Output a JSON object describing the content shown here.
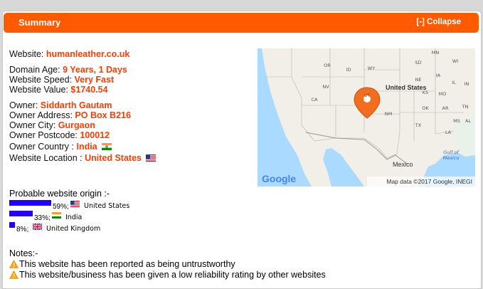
{
  "header": {
    "title": "Summary",
    "collapse_label": "[-] Collapse"
  },
  "website": {
    "label": "Website:",
    "value": "humanleather.co.uk"
  },
  "domain_age": {
    "label": "Domain Age:",
    "value": "9 Years, 1 Days"
  },
  "speed": {
    "label": "Website Speed:",
    "value": "Very Fast"
  },
  "site_value": {
    "label": "Website Value:",
    "value": "$1740.54"
  },
  "owner": {
    "label": "Owner:",
    "value": "Siddarth Gautam"
  },
  "owner_address": {
    "label": "Owner Address:",
    "value": "PO Box B216"
  },
  "owner_city": {
    "label": "Owner City:",
    "value": "Gurgaon"
  },
  "owner_postcode": {
    "label": "Owner Postcode:",
    "value": "100012"
  },
  "owner_country": {
    "label": "Owner Country :",
    "value": "India",
    "flag": "india-flag-icon"
  },
  "website_location": {
    "label": "Website Location  :",
    "value": "United States",
    "flag": "us-flag-icon"
  },
  "origin": {
    "title": "Probable website origin :-",
    "items": [
      {
        "percent_text": "59%;",
        "percent": 59,
        "country": "United States",
        "flag": "us-flag-icon"
      },
      {
        "percent_text": "33%;",
        "percent": 33,
        "country": "India",
        "flag": "india-flag-icon"
      },
      {
        "percent_text": "8%;",
        "percent": 8,
        "country": "United Kingdom",
        "flag": "uk-flag-icon"
      }
    ]
  },
  "notes": {
    "title": "Notes:-",
    "items": [
      "This website has been reported as being untrustworthy",
      "This website/business has been given a low reliability rating by other websites"
    ]
  },
  "map": {
    "logo": "Google",
    "attribution": "Map data ©2017 Google, INEGI",
    "labels": {
      "or": "OR",
      "id": "ID",
      "wy": "WY",
      "sd": "SD",
      "mn": "MN",
      "wi": "WI",
      "ne": "NE",
      "ia": "IA",
      "il": "IL",
      "in": "IN",
      "nv": "NV",
      "ut": "UT",
      "co": "CO",
      "ks": "KS",
      "mo": "MO",
      "ca": "CA",
      "ok": "OK",
      "ar": "AR",
      "tn": "TN",
      "nm": "NM",
      "ms": "MS",
      "al": "AL",
      "tx": "TX",
      "la": "LA",
      "az": "AZ",
      "country": "United States",
      "mexico": "Mexico",
      "gulf": "Gulf of Mexico",
      "gulf1": "Gulf of",
      "gulf2": "Mexico"
    },
    "colors": {
      "water": "#aadaff",
      "land": "#f2efe9",
      "pin": "#f26d1d"
    }
  },
  "colors": {
    "accent": "#ff5a00",
    "value": "#ff3c00",
    "bar": "#2200ff",
    "warning": "#f5a623"
  }
}
